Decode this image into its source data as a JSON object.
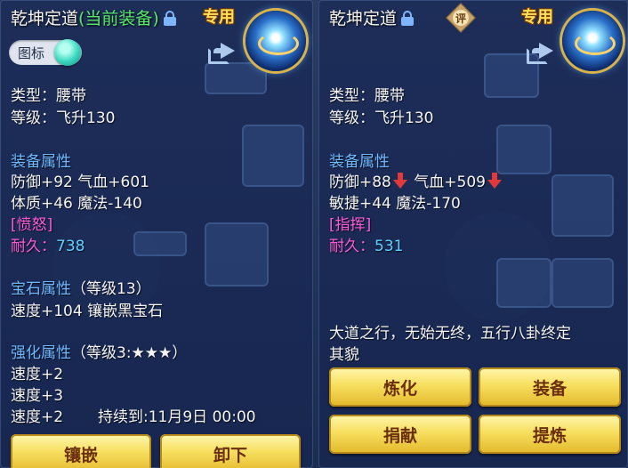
{
  "left_panel": {
    "title": "乾坤定道",
    "title_status": "(当前装备)",
    "exclusive_badge": "专用",
    "icon_toggle_label": "图标",
    "basic": {
      "type": "类型：腰带",
      "level": "等级：飞升130"
    },
    "equip_attr_header": "装备属性",
    "attr_line1": "防御+92 气血+601",
    "attr_line2": "体质+46 魔法-140",
    "special_effect": "[愤怒]",
    "durability_label": "耐久：",
    "durability_value": "738",
    "gem_header": "宝石属性",
    "gem_level": "（等级13）",
    "gem_line": "速度+104 镶嵌黑宝石",
    "enhance_header": "强化属性",
    "enhance_level": "（等级3:★★★）",
    "enhance_lines": [
      "速度+2",
      "速度+3",
      "速度+2"
    ],
    "enhance_duration": "持续到:11月9日 00:00",
    "buttons": {
      "inlay": "镶嵌",
      "unequip": "卸下"
    }
  },
  "right_panel": {
    "title": "乾坤定道",
    "rate_badge": "评",
    "exclusive_badge": "专用",
    "basic": {
      "type": "类型：腰带",
      "level": "等级：飞升130"
    },
    "equip_attr_header": "装备属性",
    "attr_def": "防御+88",
    "attr_hp": "气血+509",
    "attr_line2": "敏捷+44 魔法-170",
    "special_effect": "[指挥]",
    "durability_label": "耐久：",
    "durability_value": "531",
    "description_line1": "大道之行，无始无终，五行八卦终定",
    "description_line2": "其貌",
    "buttons": {
      "refine": "炼化",
      "equip": "装备",
      "donate": "捐献",
      "extract": "提炼"
    }
  },
  "colors": {
    "panel_bg": "#1c2c58",
    "white_text": "#f4f4f4",
    "attr_header": "#6fb8ff",
    "special_effect": "#ff5ad6",
    "durability": "#5fd0ff",
    "status_green": "#58e86a",
    "exclusive_yellow": "#ffe05a",
    "button_gold": "#f7df5f",
    "down_arrow_red": "#e23a3a"
  }
}
